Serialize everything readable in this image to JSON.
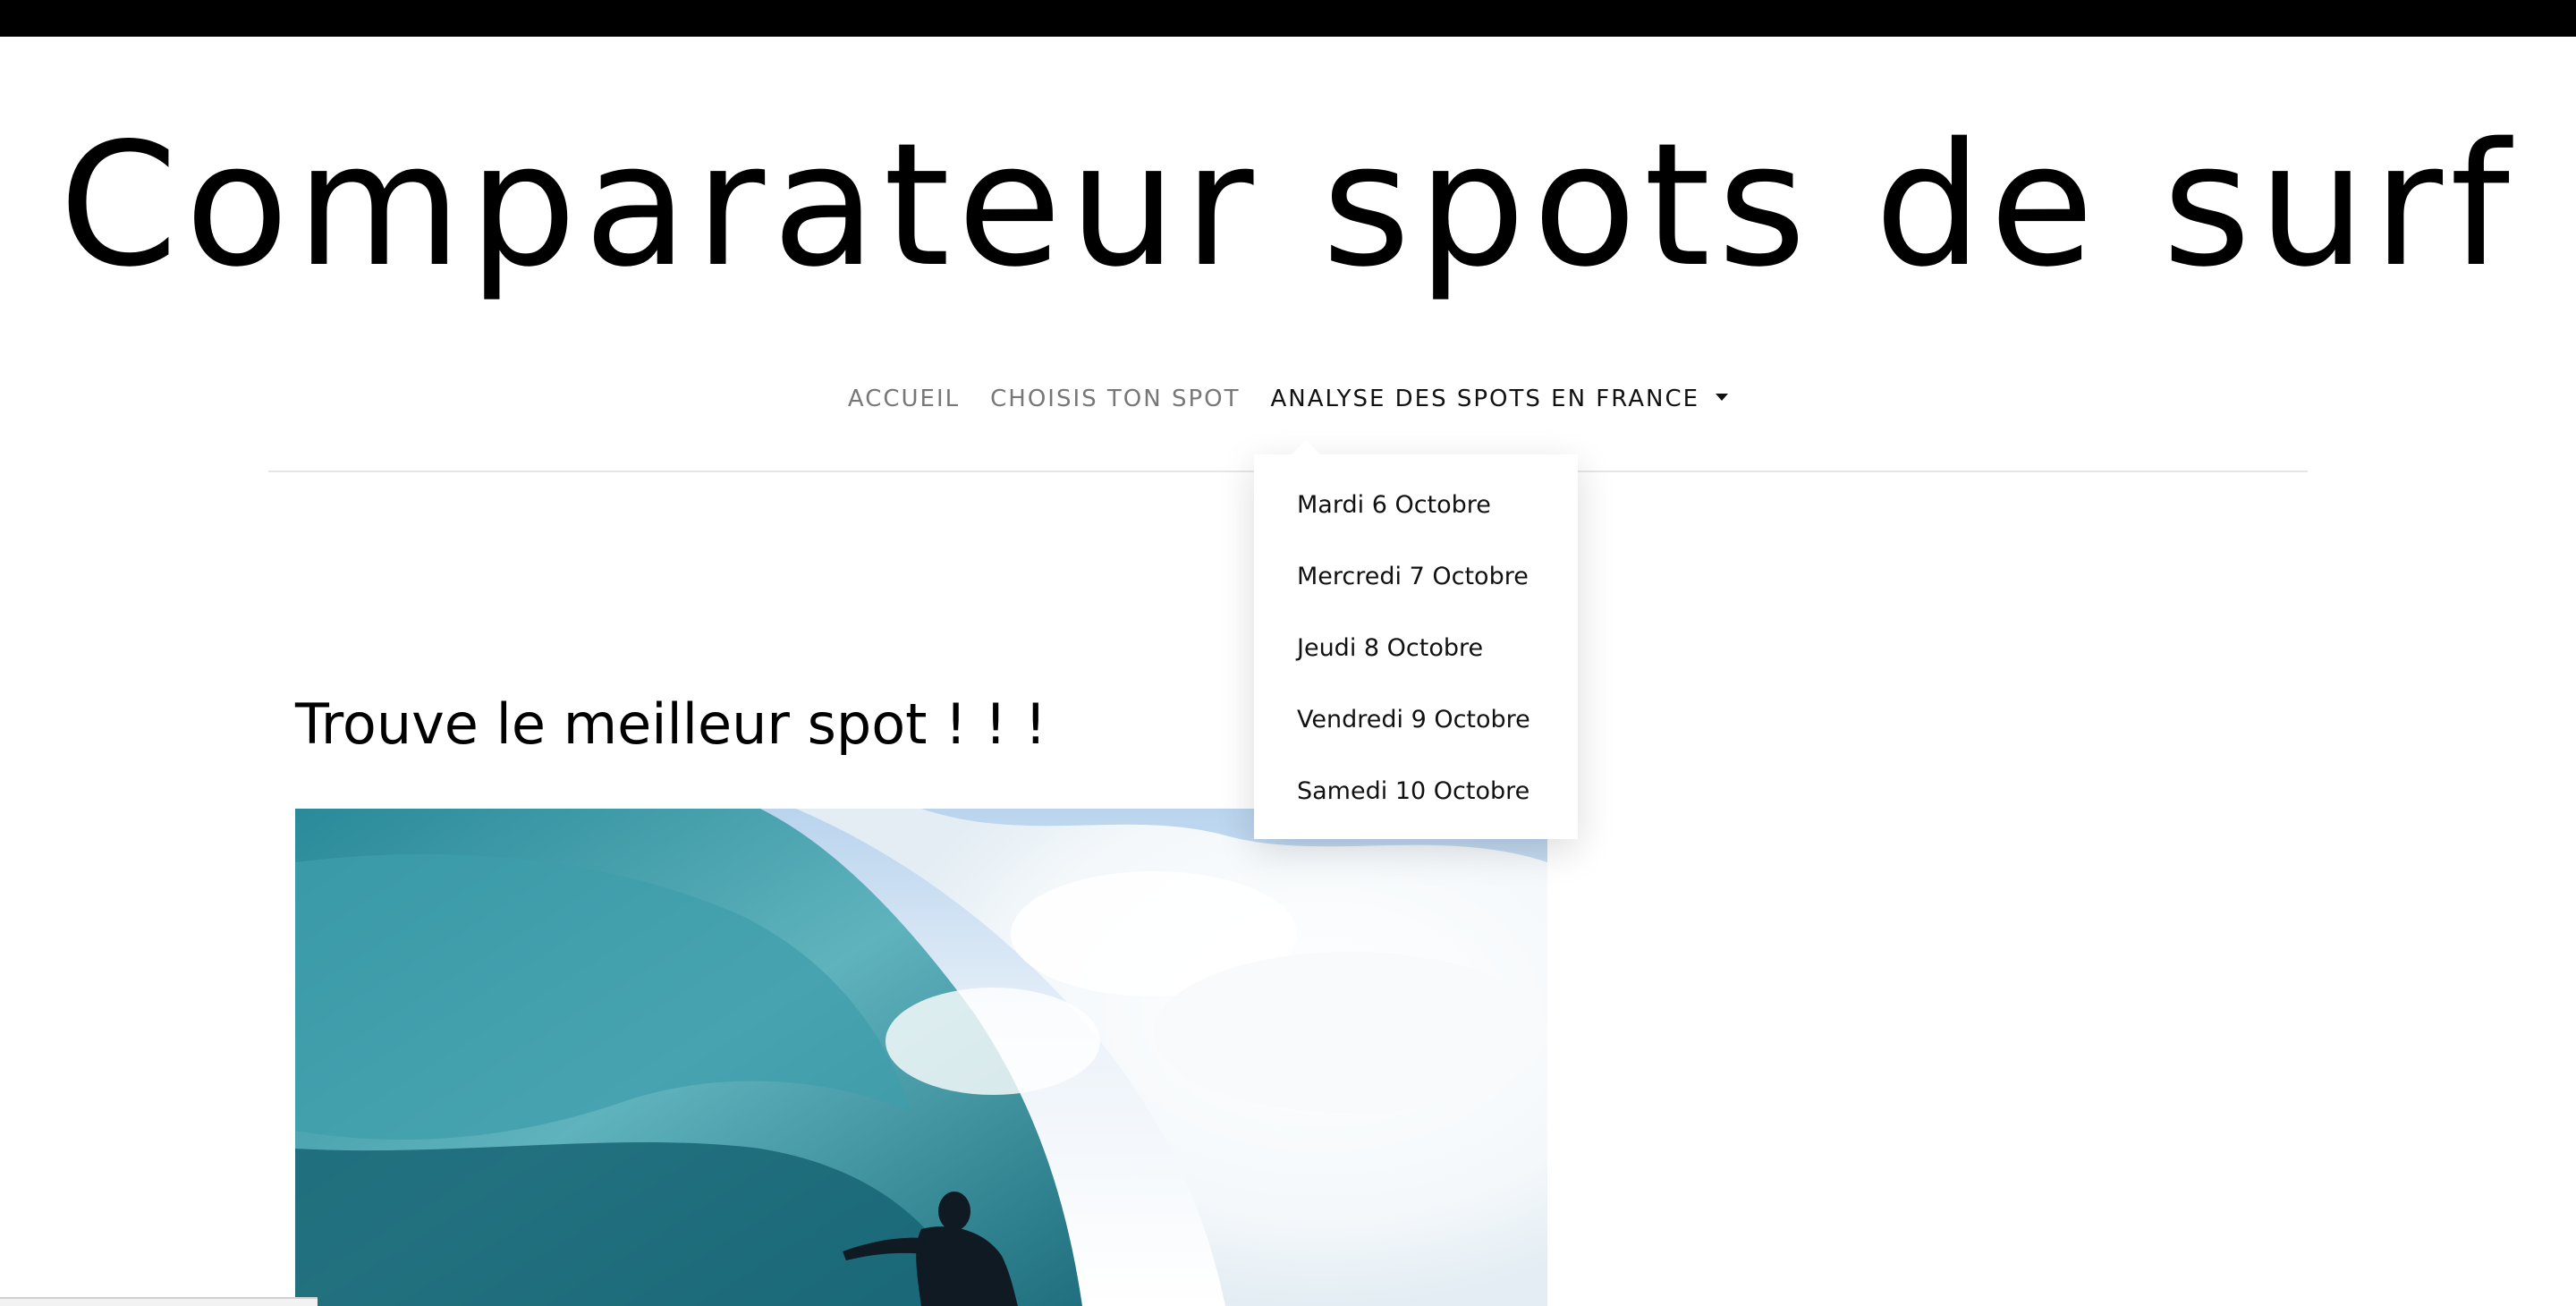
{
  "site": {
    "title": "Comparateur spots de surf"
  },
  "nav": {
    "items": [
      {
        "label": "ACCUEIL"
      },
      {
        "label": "CHOISIS TON SPOT"
      },
      {
        "label": "ANALYSE DES SPOTS EN FRANCE"
      }
    ],
    "dropdown": {
      "items": [
        {
          "label": "Mardi 6 Octobre"
        },
        {
          "label": "Mercredi 7 Octobre"
        },
        {
          "label": "Jeudi 8 Octobre"
        },
        {
          "label": "Vendredi 9 Octobre"
        },
        {
          "label": "Samedi 10 Octobre"
        }
      ]
    }
  },
  "main": {
    "heading": "Trouve le meilleur spot ! ! !"
  },
  "colors": {
    "top_bar": "#000000",
    "nav_inactive": "#777777",
    "nav_active": "#111111",
    "wave_deep": "#1f6f7e",
    "wave_light": "#5fb3bd",
    "sky": "#b9d4ee"
  },
  "icons": {
    "dropdown_toggle": "caret-down-icon"
  }
}
